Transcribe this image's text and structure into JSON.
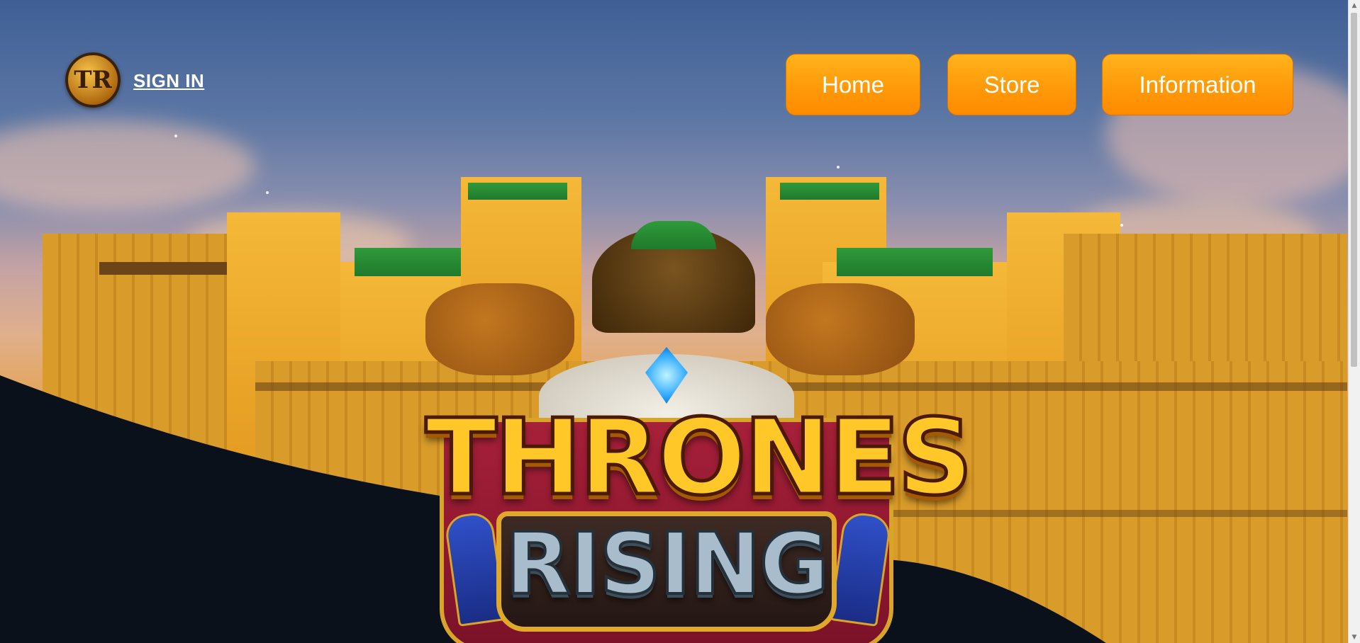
{
  "header": {
    "logo_text": "TR",
    "signin_label": "SIGN IN"
  },
  "nav": {
    "home": "Home",
    "store": "Store",
    "information": "Information"
  },
  "hero": {
    "game_title_line1": "THRONES",
    "game_title_line2": "RISING"
  },
  "colors": {
    "button_orange": "#ff9a0a",
    "dark_band": "#0b111b",
    "title_gold": "#ffc828"
  },
  "icons": {
    "logo": "tr-logo-icon",
    "scroll_up": "scroll-up-arrow-icon",
    "scroll_down": "scroll-down-arrow-icon"
  }
}
